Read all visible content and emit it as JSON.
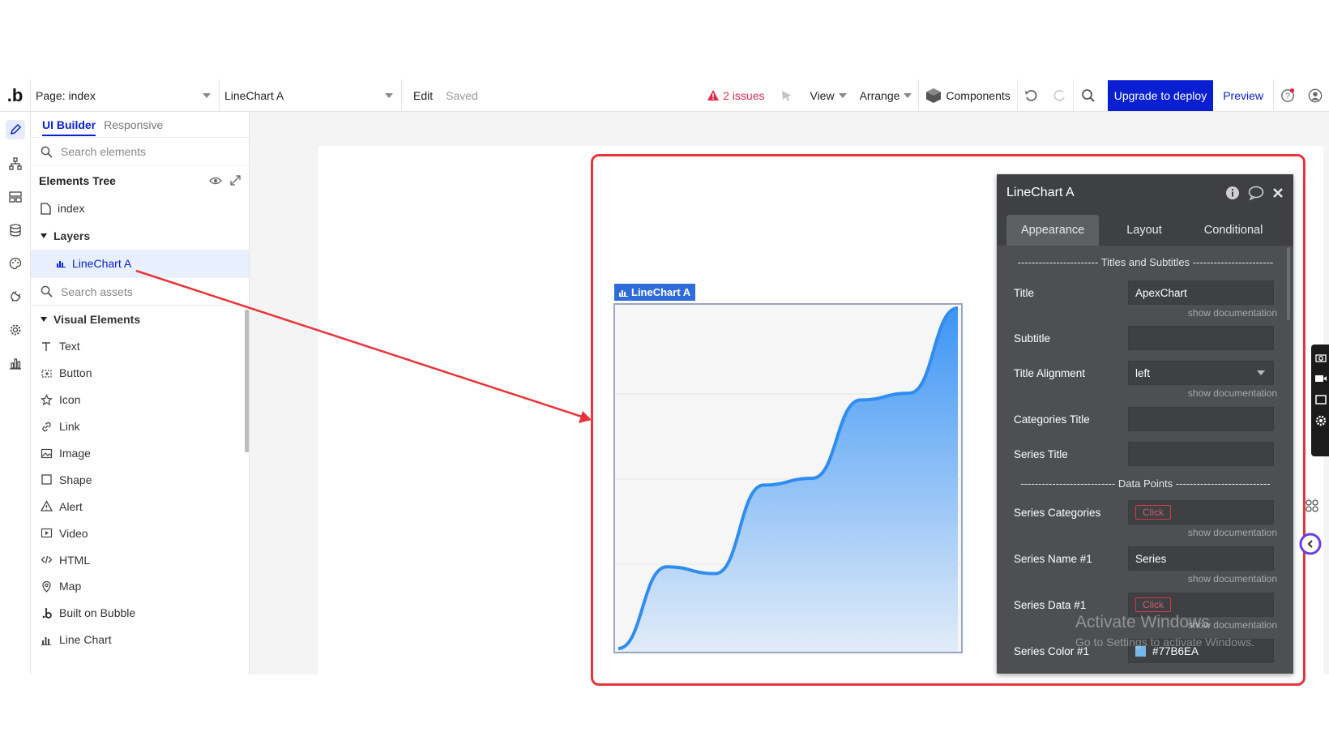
{
  "topbar": {
    "logo": ".b",
    "page_select": "Page: index",
    "element_select": "LineChart A",
    "edit": "Edit",
    "saved": "Saved",
    "issues": "2 issues",
    "view": "View",
    "arrange": "Arrange",
    "components": "Components",
    "upgrade": "Upgrade to deploy",
    "preview": "Preview"
  },
  "panel": {
    "tab_active": "UI Builder",
    "tab_other": "Responsive",
    "search_elements_placeholder": "Search elements",
    "tree_title": "Elements Tree",
    "tree": {
      "index": "index",
      "layers": "Layers",
      "linechart": "LineChart A"
    },
    "search_assets_placeholder": "Search assets",
    "visual_elements": "Visual Elements",
    "elements": [
      {
        "label": "Text",
        "icon": "text-icon"
      },
      {
        "label": "Button",
        "icon": "button-icon"
      },
      {
        "label": "Icon",
        "icon": "star-icon"
      },
      {
        "label": "Link",
        "icon": "link-icon"
      },
      {
        "label": "Image",
        "icon": "image-icon"
      },
      {
        "label": "Shape",
        "icon": "square-icon"
      },
      {
        "label": "Alert",
        "icon": "alert-icon"
      },
      {
        "label": "Video",
        "icon": "video-icon"
      },
      {
        "label": "HTML",
        "icon": "code-icon"
      },
      {
        "label": "Map",
        "icon": "map-pin-icon"
      },
      {
        "label": "Built on Bubble",
        "icon": "bubble-logo-icon"
      },
      {
        "label": "Line Chart",
        "icon": "bar-chart-icon"
      }
    ]
  },
  "canvas": {
    "chip_label": "LineChart A",
    "chart_curve_y": [
      0.0,
      0.24,
      0.22,
      0.48,
      0.5,
      0.73,
      0.75,
      1.0
    ]
  },
  "editor": {
    "title": "LineChart A",
    "tabs": [
      "Appearance",
      "Layout",
      "Conditional"
    ],
    "section_titles": "----------------------- Titles and Subtitles -----------------------",
    "section_data": "--------------------------- Data Points ---------------------------",
    "fields": {
      "title_label": "Title",
      "title_value": "ApexChart",
      "subtitle_label": "Subtitle",
      "subtitle_value": "",
      "title_alignment_label": "Title Alignment",
      "title_alignment_value": "left",
      "categories_title_label": "Categories Title",
      "series_title_label": "Series Title",
      "series_categories_label": "Series Categories",
      "series_name_label": "Series Name #1",
      "series_name_value": "Series",
      "series_data_label": "Series Data #1",
      "series_color_label": "Series Color #1",
      "series_color_value": "#77B6EA",
      "click_label": "Click",
      "doc_label": "show documentation"
    }
  },
  "watermark": {
    "line1": "Activate Windows",
    "line2": "Go to Settings to activate Windows."
  },
  "colors": {
    "brand_blue": "#0a1fd1",
    "highlight_red": "#e8343a",
    "series_color": "#77b6ea",
    "chart_line": "#2f8cf0"
  }
}
